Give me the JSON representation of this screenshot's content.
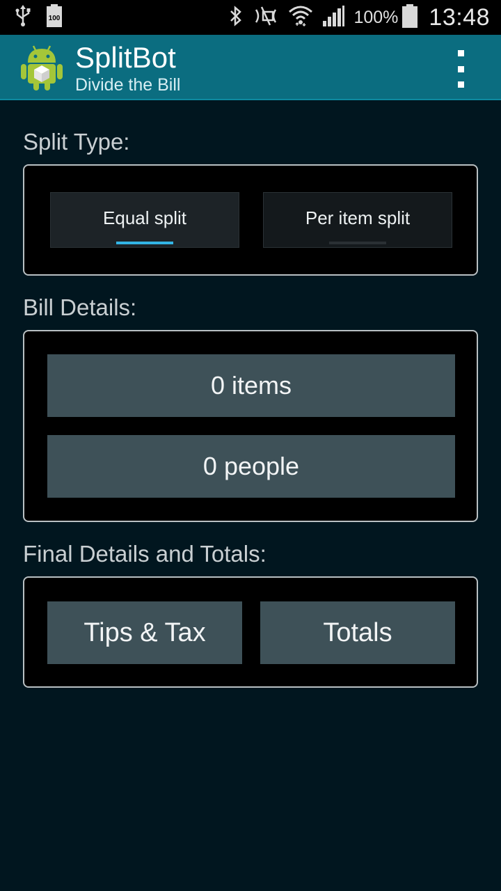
{
  "status_bar": {
    "icons_left": [
      "usb-icon",
      "battery-100-notification-icon"
    ],
    "battery_badge": "100",
    "icons_right": [
      "bluetooth-icon",
      "nfc-off-icon",
      "wifi-icon",
      "signal-icon",
      "battery-icon"
    ],
    "battery_percent": "100%",
    "time": "13:48"
  },
  "action_bar": {
    "title": "SplitBot",
    "subtitle": "Divide the Bill",
    "icon": "android-robot-icon",
    "overflow_icon": "overflow-menu-icon"
  },
  "split_type": {
    "label": "Split Type:",
    "tabs": [
      {
        "label": "Equal split",
        "selected": true
      },
      {
        "label": "Per item split",
        "selected": false
      }
    ]
  },
  "bill_details": {
    "label": "Bill Details:",
    "items_button": "0 items",
    "people_button": "0 people"
  },
  "final_details": {
    "label": "Final Details and Totals:",
    "tips_button": "Tips & Tax",
    "totals_button": "Totals"
  },
  "colors": {
    "background": "#01161f",
    "action_bar": "#0b6d80",
    "button": "#3e5158",
    "selected_indicator": "#33b5e5"
  }
}
